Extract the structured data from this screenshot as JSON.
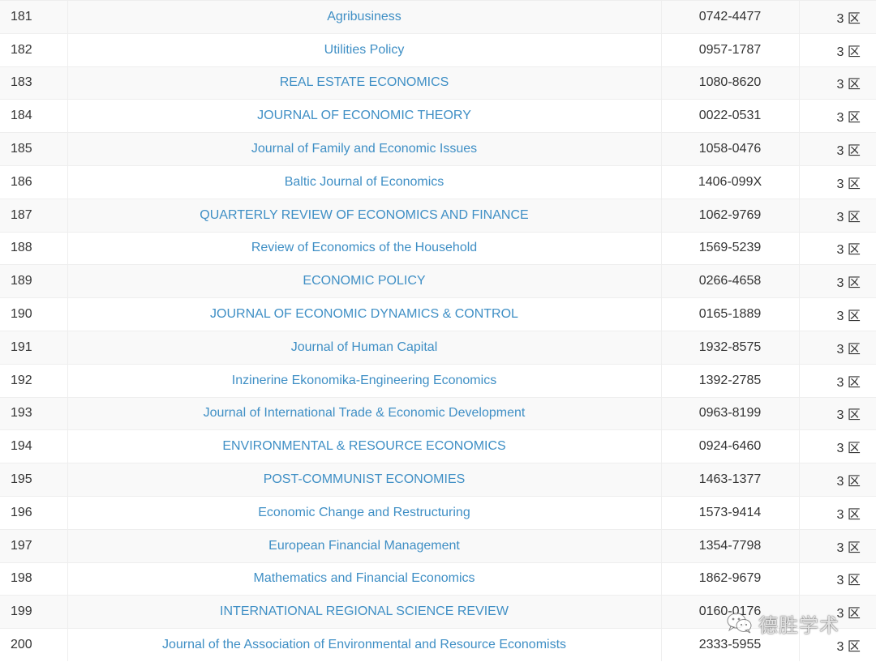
{
  "rows": [
    {
      "rank": "181",
      "title": "Agribusiness",
      "issn": "0742-4477",
      "zone": "3 区"
    },
    {
      "rank": "182",
      "title": "Utilities Policy",
      "issn": "0957-1787",
      "zone": "3 区"
    },
    {
      "rank": "183",
      "title": "REAL ESTATE ECONOMICS",
      "issn": "1080-8620",
      "zone": "3 区"
    },
    {
      "rank": "184",
      "title": "JOURNAL OF ECONOMIC THEORY",
      "issn": "0022-0531",
      "zone": "3 区"
    },
    {
      "rank": "185",
      "title": "Journal of Family and Economic Issues",
      "issn": "1058-0476",
      "zone": "3 区"
    },
    {
      "rank": "186",
      "title": "Baltic Journal of Economics",
      "issn": "1406-099X",
      "zone": "3 区"
    },
    {
      "rank": "187",
      "title": "QUARTERLY REVIEW OF ECONOMICS AND FINANCE",
      "issn": "1062-9769",
      "zone": "3 区"
    },
    {
      "rank": "188",
      "title": "Review of Economics of the Household",
      "issn": "1569-5239",
      "zone": "3 区"
    },
    {
      "rank": "189",
      "title": "ECONOMIC POLICY",
      "issn": "0266-4658",
      "zone": "3 区"
    },
    {
      "rank": "190",
      "title": "JOURNAL OF ECONOMIC DYNAMICS & CONTROL",
      "issn": "0165-1889",
      "zone": "3 区"
    },
    {
      "rank": "191",
      "title": "Journal of Human Capital",
      "issn": "1932-8575",
      "zone": "3 区"
    },
    {
      "rank": "192",
      "title": "Inzinerine Ekonomika-Engineering Economics",
      "issn": "1392-2785",
      "zone": "3 区"
    },
    {
      "rank": "193",
      "title": "Journal of International Trade & Economic Development",
      "issn": "0963-8199",
      "zone": "3 区"
    },
    {
      "rank": "194",
      "title": "ENVIRONMENTAL & RESOURCE ECONOMICS",
      "issn": "0924-6460",
      "zone": "3 区"
    },
    {
      "rank": "195",
      "title": "POST-COMMUNIST ECONOMIES",
      "issn": "1463-1377",
      "zone": "3 区"
    },
    {
      "rank": "196",
      "title": "Economic Change and Restructuring",
      "issn": "1573-9414",
      "zone": "3 区"
    },
    {
      "rank": "197",
      "title": "European Financial Management",
      "issn": "1354-7798",
      "zone": "3 区"
    },
    {
      "rank": "198",
      "title": "Mathematics and Financial Economics",
      "issn": "1862-9679",
      "zone": "3 区"
    },
    {
      "rank": "199",
      "title": "INTERNATIONAL REGIONAL SCIENCE REVIEW",
      "issn": "0160-0176",
      "zone": "3 区"
    },
    {
      "rank": "200",
      "title": "Journal of the Association of Environmental and Resource Economists",
      "issn": "2333-5955",
      "zone": "3 区"
    }
  ],
  "watermark": {
    "text": "德胜学术",
    "icon": "wechat-icon"
  },
  "colors": {
    "link": "#3f8fc5",
    "text": "#333333",
    "stripe": "#f9f9f9",
    "border": "#eeeeee"
  }
}
